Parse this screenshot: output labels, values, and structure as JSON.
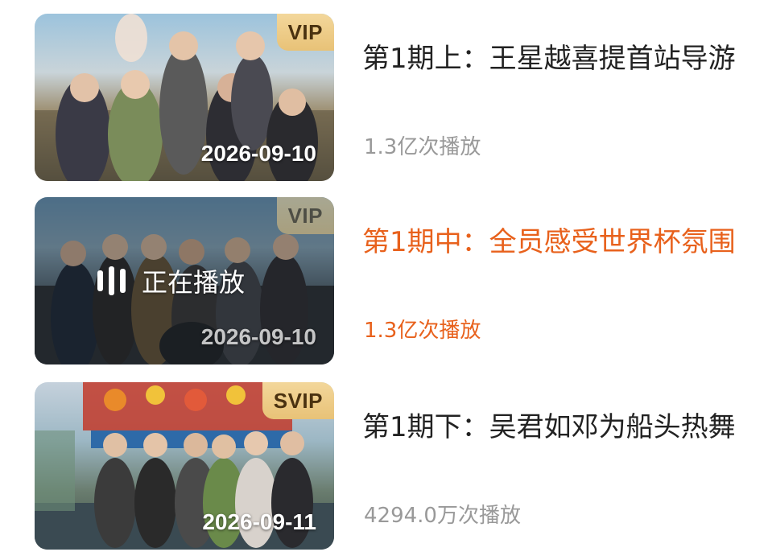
{
  "colors": {
    "active_orange": "#e8611c",
    "title_default": "#222222",
    "views_default": "#999999",
    "badge_gold": "#e8c277"
  },
  "episodes": [
    {
      "title": "第1期上：王星越喜提首站导游",
      "views": "1.3亿次播放",
      "date": "2026-09-10",
      "badge": "VIP",
      "active": false
    },
    {
      "title": "第1期中：全员感受世界杯氛围",
      "views": "1.3亿次播放",
      "date": "2026-09-10",
      "badge": "VIP",
      "active": true,
      "playing_label": "正在播放",
      "playing_icon": "equalizer-bars-icon"
    },
    {
      "title": "第1期下：吴君如邓为船头热舞",
      "views": "4294.0万次播放",
      "date": "2026-09-11",
      "badge": "SVIP",
      "active": false
    }
  ]
}
